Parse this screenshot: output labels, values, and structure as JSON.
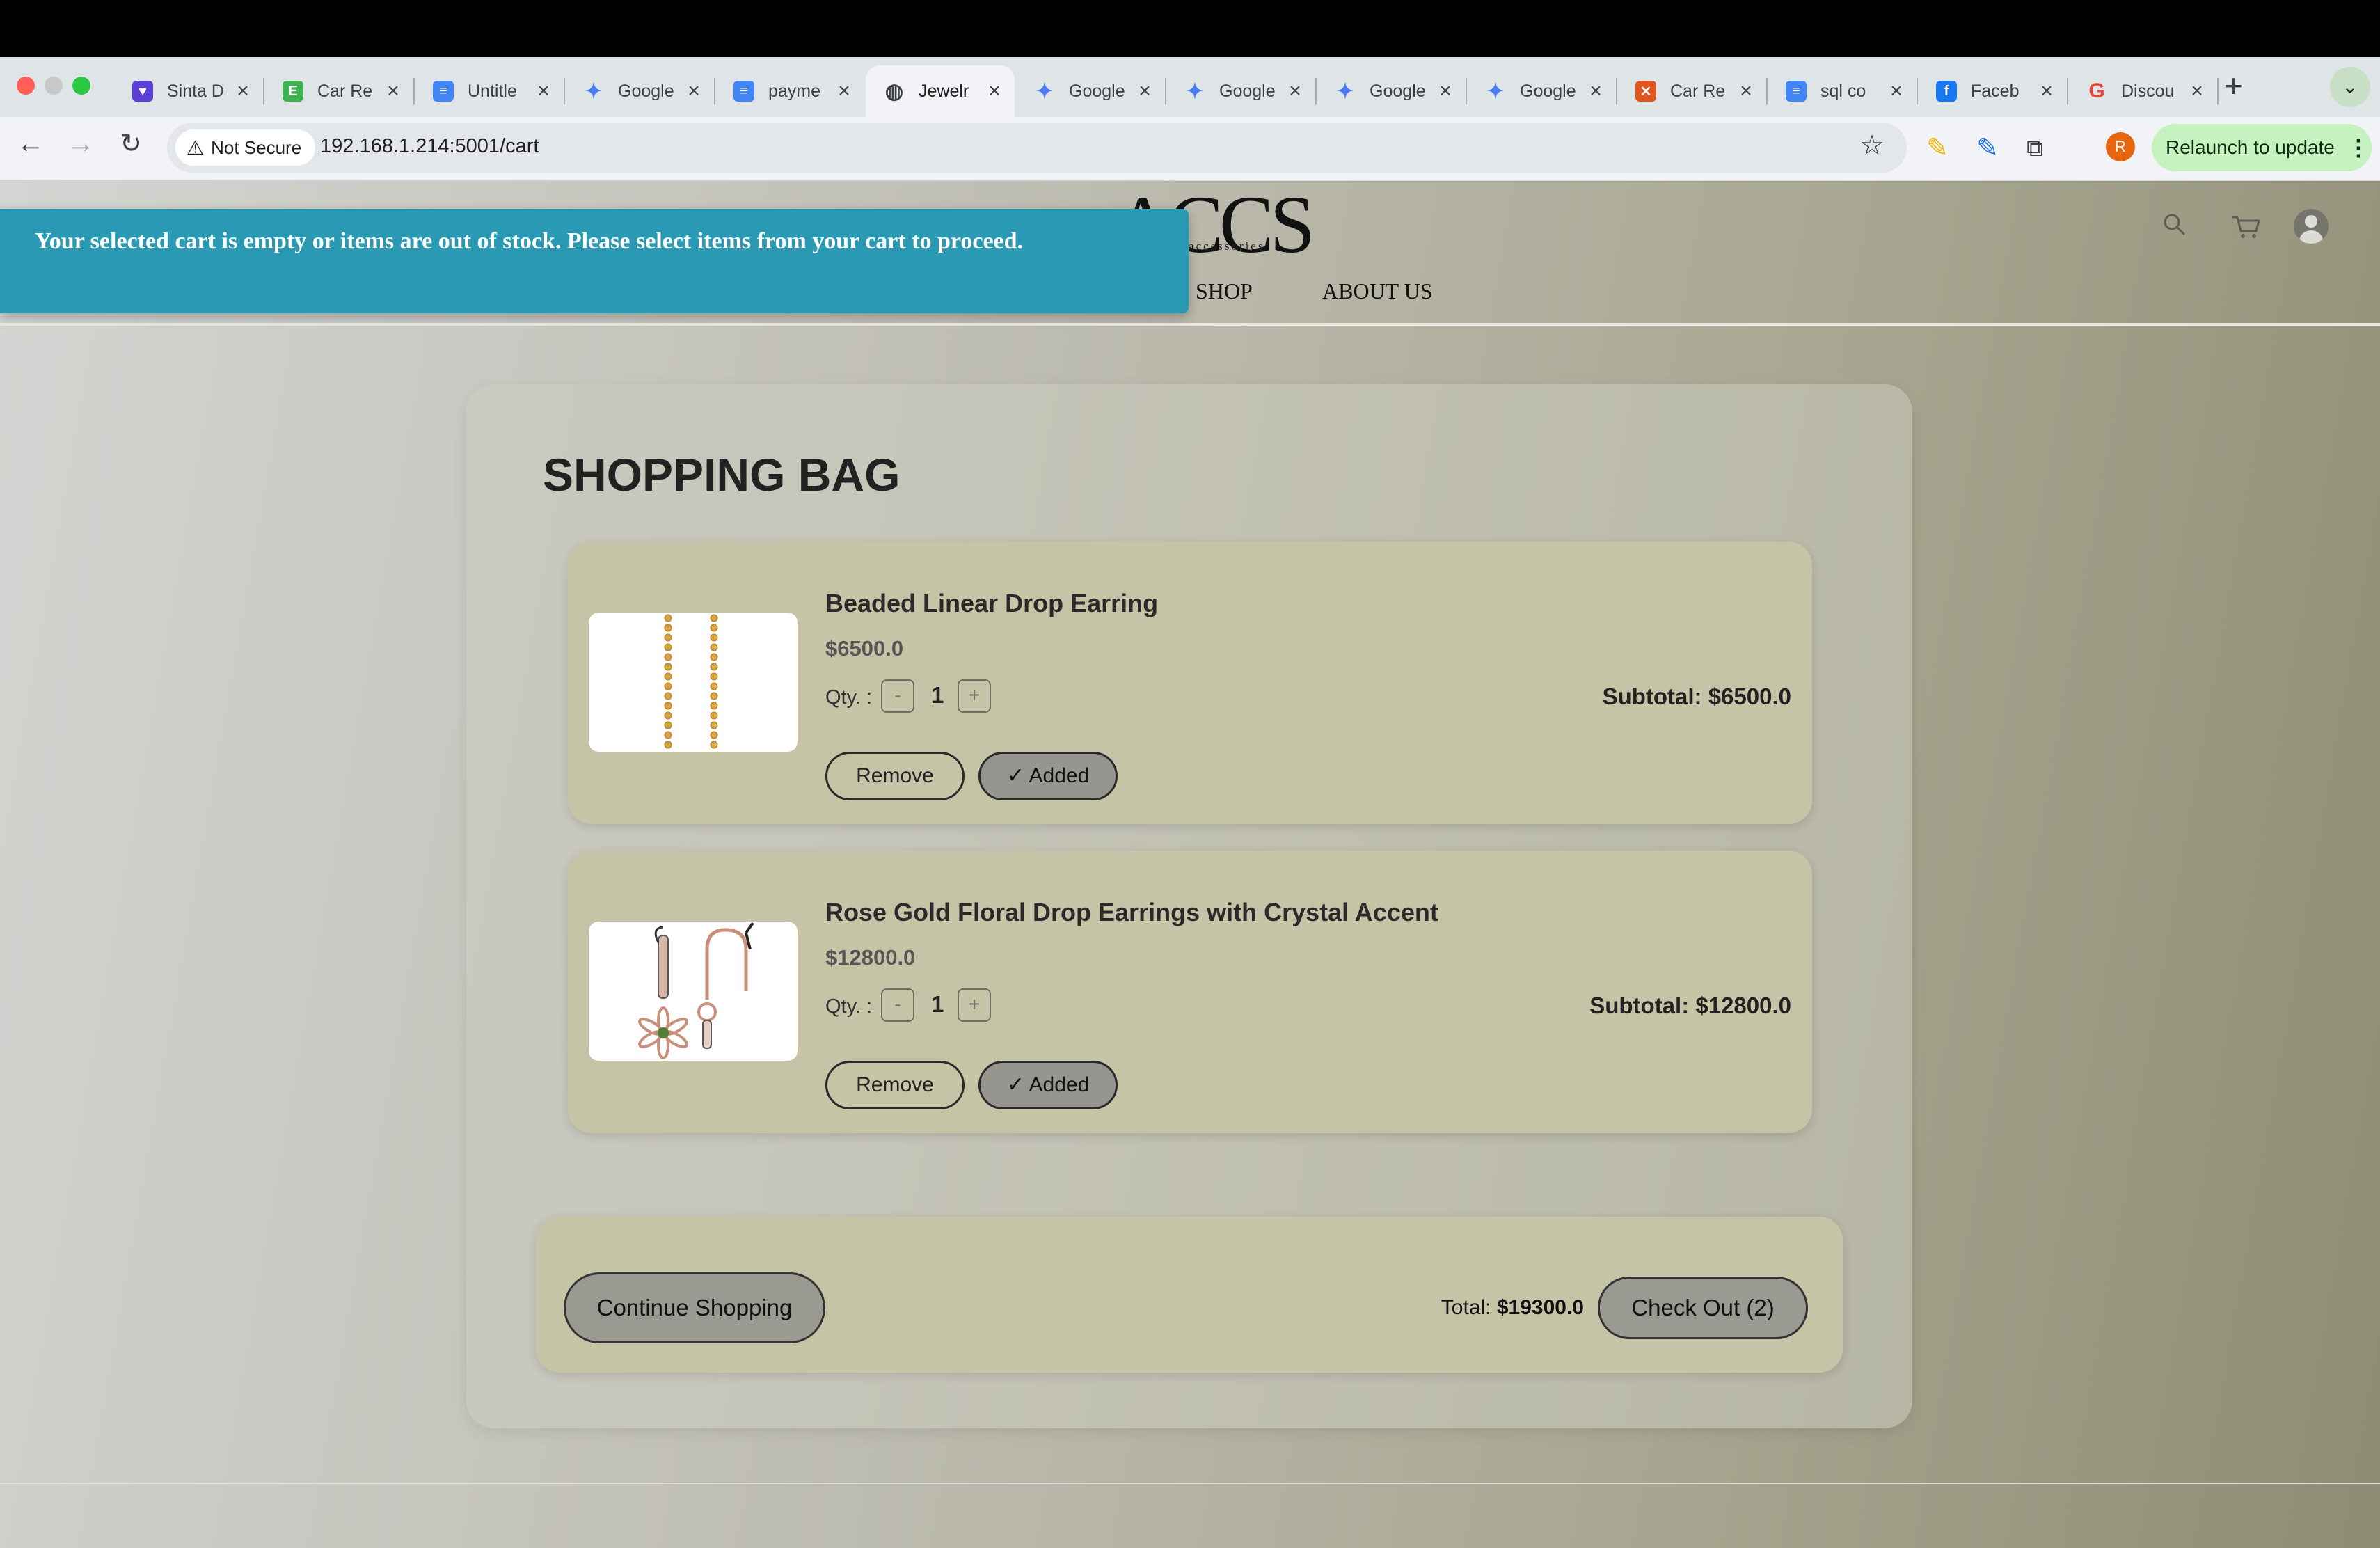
{
  "browser": {
    "tabs": [
      {
        "title": "Sinta D",
        "icon": "heart-shield-icon",
        "color": "#5b3fd6",
        "active": false
      },
      {
        "title": "Car Re",
        "icon": "e-logo-icon",
        "color": "#3fb34f",
        "active": false
      },
      {
        "title": "Untitle",
        "icon": "docs-icon",
        "color": "#4285f4",
        "active": false
      },
      {
        "title": "Google",
        "icon": "gemini-icon",
        "color": "#4a7ef0",
        "active": false
      },
      {
        "title": "payme",
        "icon": "docs-icon",
        "color": "#4285f4",
        "active": false
      },
      {
        "title": "Jewelr",
        "icon": "globe-icon",
        "color": "#3c4043",
        "active": true
      },
      {
        "title": "Google",
        "icon": "gemini-icon",
        "color": "#4a7ef0",
        "active": false
      },
      {
        "title": "Google",
        "icon": "gemini-icon",
        "color": "#4a7ef0",
        "active": false
      },
      {
        "title": "Google",
        "icon": "gemini-icon",
        "color": "#4a7ef0",
        "active": false
      },
      {
        "title": "Google",
        "icon": "gemini-icon",
        "color": "#4a7ef0",
        "active": false
      },
      {
        "title": "Car Re",
        "icon": "xampp-icon",
        "color": "#e0561f",
        "active": false
      },
      {
        "title": "sql co",
        "icon": "docs-icon",
        "color": "#4285f4",
        "active": false
      },
      {
        "title": "Faceb",
        "icon": "facebook-icon",
        "color": "#1877f2",
        "active": false
      },
      {
        "title": "Discou",
        "icon": "google-g-icon",
        "color": "#ea4335",
        "active": false
      }
    ],
    "security_label": "Not Secure",
    "url": "192.168.1.214:5001/cart",
    "profile_initial": "R",
    "relaunch_label": "Relaunch to update"
  },
  "site": {
    "logo": "ACCS",
    "logo_sub": "accessories",
    "nav": {
      "shop": "SHOP",
      "about": "ABOUT US"
    }
  },
  "toast": {
    "message": "Your selected cart is empty or items are out of stock. Please select items from your cart to proceed.",
    "color": "#2a9ab4"
  },
  "cart": {
    "title": "SHOPPING BAG",
    "qty_label": "Qty. :",
    "minus": "-",
    "plus": "+",
    "remove_label": "Remove",
    "added_label": "✓ Added",
    "items": [
      {
        "name": "Beaded Linear Drop Earring",
        "price": "$6500.0",
        "qty": "1",
        "subtotal": "Subtotal: $6500.0"
      },
      {
        "name": "Rose Gold Floral Drop Earrings with Crystal Accent",
        "price": "$12800.0",
        "qty": "1",
        "subtotal": "Subtotal: $12800.0"
      }
    ],
    "continue_label": "Continue Shopping",
    "total_label": "Total:",
    "total_value": "$19300.0",
    "checkout_label": "Check Out (2)"
  }
}
